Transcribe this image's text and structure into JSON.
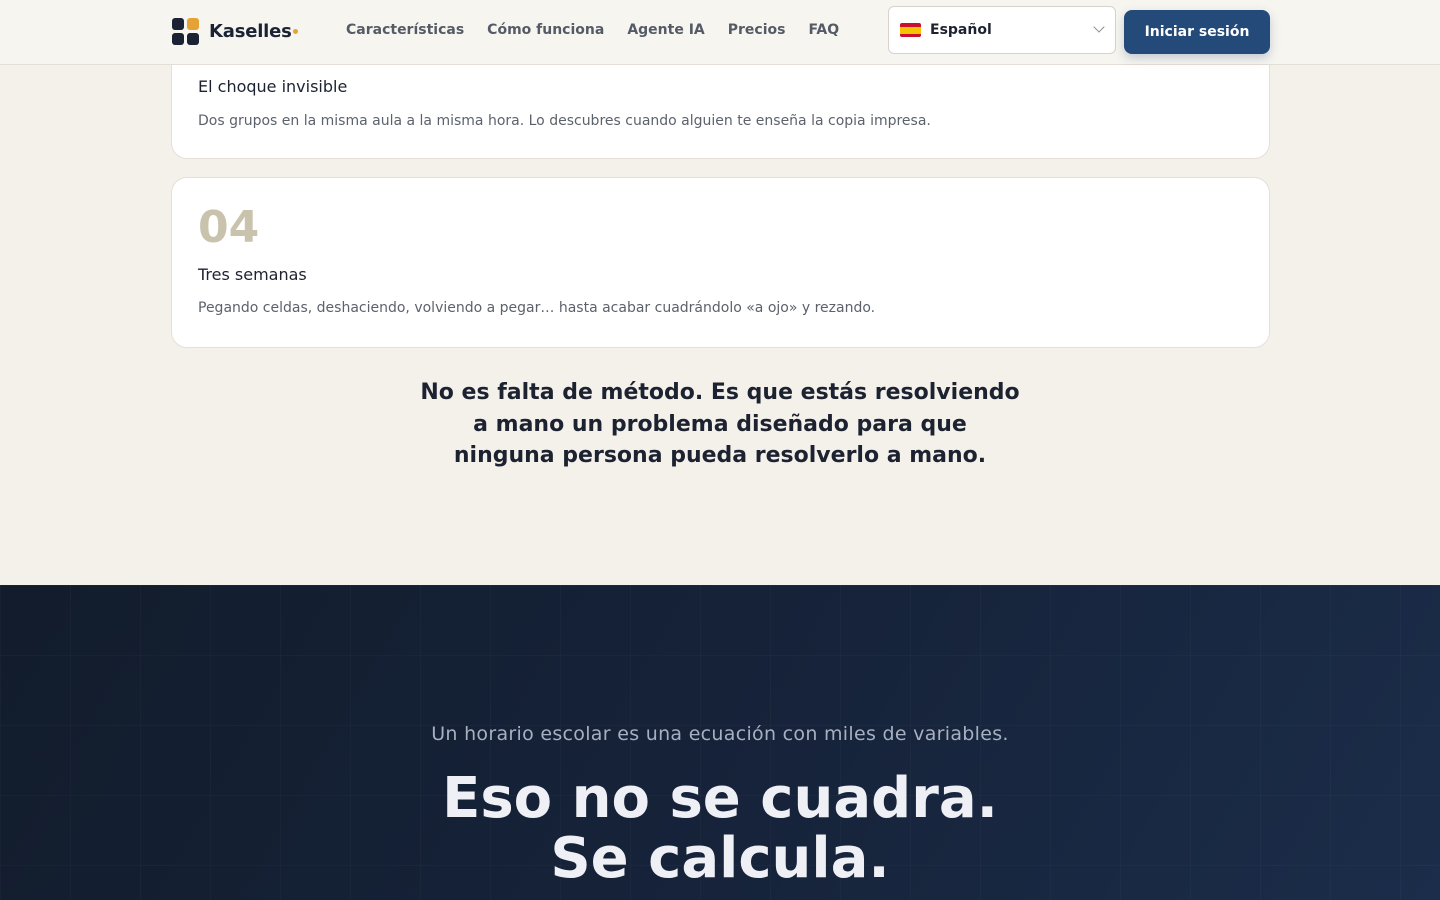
{
  "header": {
    "brand": "Kaselles",
    "nav": [
      "Características",
      "Cómo funciona",
      "Agente IA",
      "Precios",
      "FAQ"
    ],
    "language": "Español",
    "login_label": "Iniciar sesión"
  },
  "cards": [
    {
      "title": "El choque invisible",
      "description": "Dos grupos en la misma aula a la misma hora. Lo descubres cuando alguien te enseña la copia impresa."
    },
    {
      "number": "04",
      "title": "Tres semanas",
      "description": "Pegando celdas, deshaciendo, volviendo a pegar… hasta acabar cuadrándolo «a ojo» y rezando."
    }
  ],
  "statement": {
    "line1": "No es falta de método. Es que estás resolviendo",
    "line2": "a mano un problema diseñado para que",
    "line3": "ninguna persona pueda resolverlo a mano."
  },
  "hero": {
    "subtitle": "Un horario escolar es una ecuación con miles de variables.",
    "title_line1": "Eso no se cuadra.",
    "title_line2": "Se calcula."
  },
  "colors": {
    "accent": "#e5a336",
    "primary": "#234a78",
    "dark_bg": "#16233a",
    "page_bg": "#f4f1eb"
  }
}
